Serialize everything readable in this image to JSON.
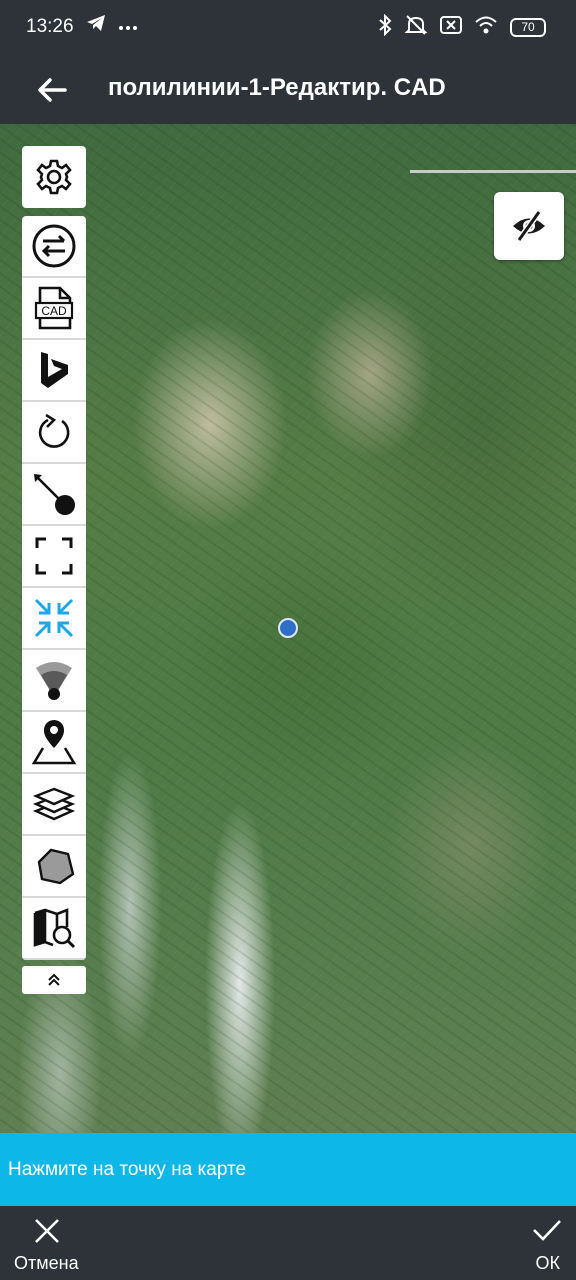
{
  "status_bar": {
    "time": "13:26",
    "left_icons": [
      "telegram-icon",
      "more-dots-icon"
    ],
    "right_icons": [
      "bluetooth-icon",
      "mute-icon",
      "close-box-icon",
      "wifi-icon"
    ],
    "battery": "70"
  },
  "app_bar": {
    "title": "полилинии-1-Редактир. CAD",
    "back_icon": "arrow-left-icon"
  },
  "map": {
    "imagery": "satellite",
    "visibility_toggle_icon": "eye-off-icon"
  },
  "toolbar": {
    "settings_icon": "gear-icon",
    "tools": [
      {
        "name": "swap-icon"
      },
      {
        "name": "cad-file-icon",
        "label": "CAD"
      },
      {
        "name": "bing-icon"
      },
      {
        "name": "refresh-icon"
      },
      {
        "name": "pin-target-icon"
      },
      {
        "name": "fullscreen-icon"
      },
      {
        "name": "collapse-arrows-icon",
        "color": "#1ea7e6"
      },
      {
        "name": "signal-cone-icon"
      },
      {
        "name": "location-pin-icon"
      },
      {
        "name": "layers-icon"
      },
      {
        "name": "polygon-icon"
      },
      {
        "name": "map-search-icon"
      }
    ],
    "collapse_icon": "chevrons-up-icon"
  },
  "hint": {
    "text": "Нажмите на точку на карте",
    "color": "#0db7e8"
  },
  "bottom_bar": {
    "cancel_label": "Отмена",
    "ok_label": "ОК"
  }
}
